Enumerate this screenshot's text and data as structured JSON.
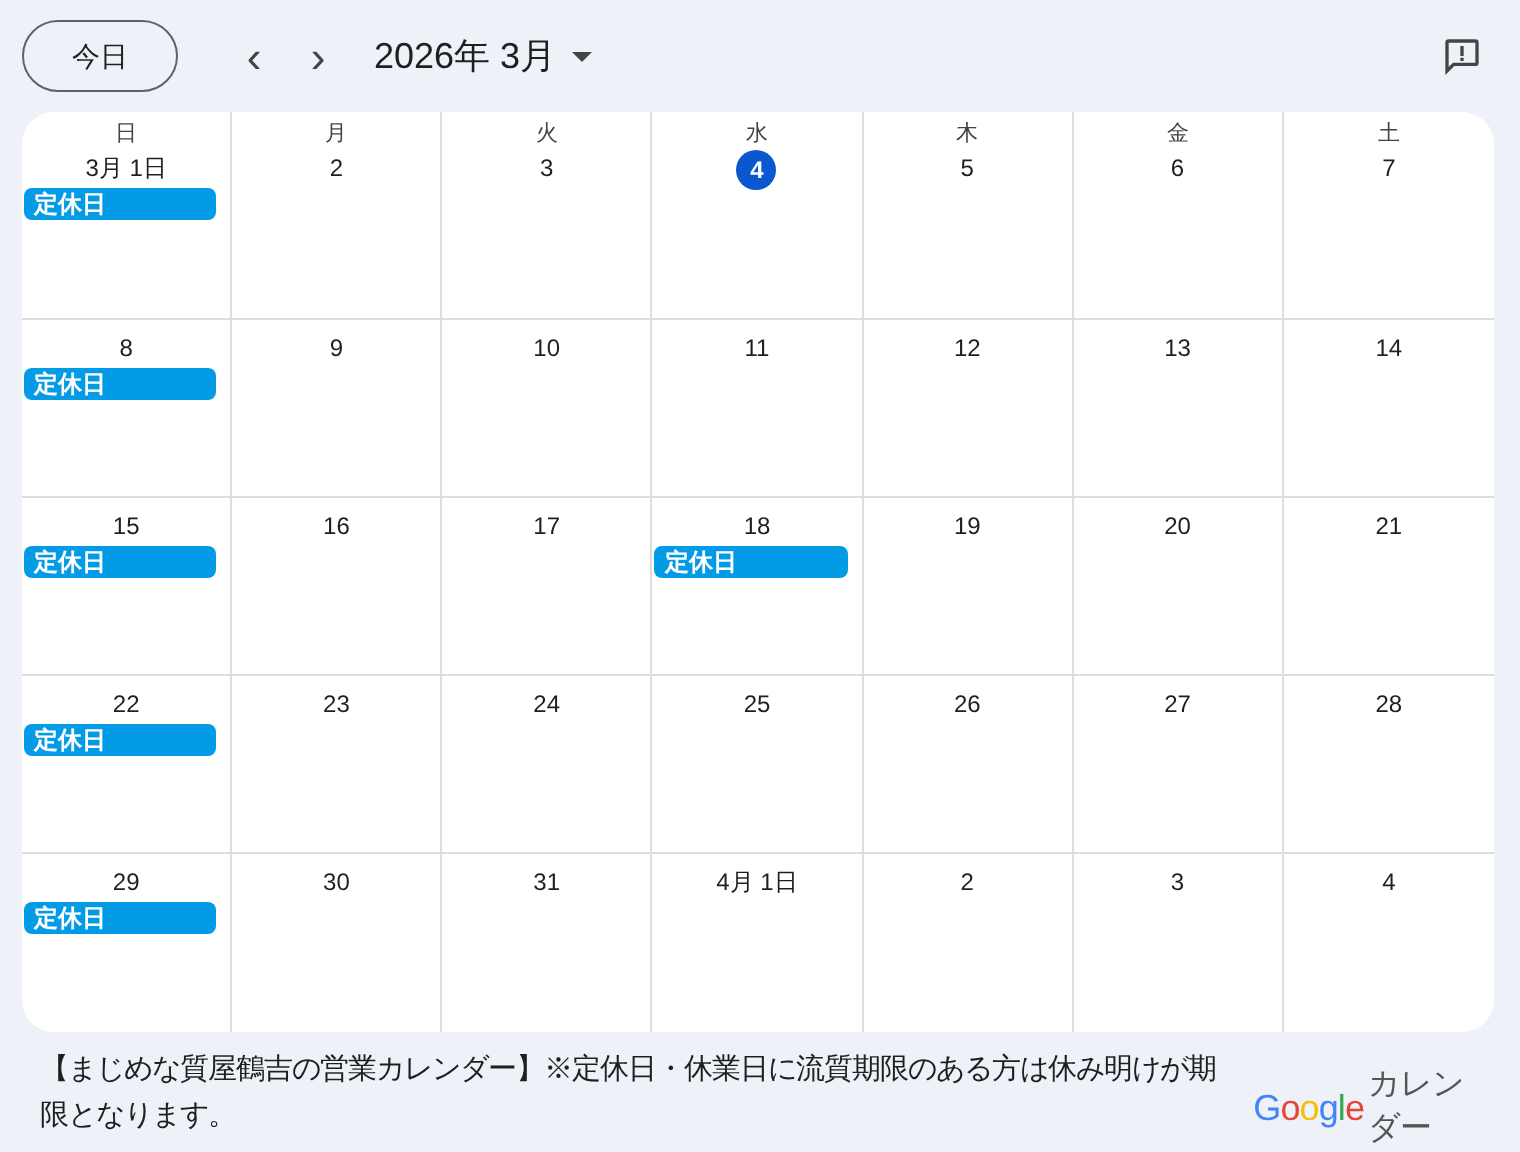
{
  "toolbar": {
    "today_button": "今日",
    "prev": "‹",
    "next": "›",
    "month_title": "2026年 3月"
  },
  "weekdays": [
    "日",
    "月",
    "火",
    "水",
    "木",
    "金",
    "土"
  ],
  "weeks": [
    {
      "days": [
        {
          "date": "3月 1日",
          "today": false,
          "events": [
            "定休日"
          ]
        },
        {
          "date": "2",
          "today": false
        },
        {
          "date": "3",
          "today": false
        },
        {
          "date": "4",
          "today": true
        },
        {
          "date": "5",
          "today": false
        },
        {
          "date": "6",
          "today": false
        },
        {
          "date": "7",
          "today": false
        }
      ]
    },
    {
      "days": [
        {
          "date": "8",
          "today": false,
          "events": [
            "定休日"
          ]
        },
        {
          "date": "9",
          "today": false
        },
        {
          "date": "10",
          "today": false
        },
        {
          "date": "11",
          "today": false
        },
        {
          "date": "12",
          "today": false
        },
        {
          "date": "13",
          "today": false
        },
        {
          "date": "14",
          "today": false
        }
      ]
    },
    {
      "days": [
        {
          "date": "15",
          "today": false,
          "events": [
            "定休日"
          ]
        },
        {
          "date": "16",
          "today": false
        },
        {
          "date": "17",
          "today": false
        },
        {
          "date": "18",
          "today": false,
          "events": [
            "定休日"
          ]
        },
        {
          "date": "19",
          "today": false
        },
        {
          "date": "20",
          "today": false
        },
        {
          "date": "21",
          "today": false
        }
      ]
    },
    {
      "days": [
        {
          "date": "22",
          "today": false,
          "events": [
            "定休日"
          ]
        },
        {
          "date": "23",
          "today": false
        },
        {
          "date": "24",
          "today": false
        },
        {
          "date": "25",
          "today": false
        },
        {
          "date": "26",
          "today": false
        },
        {
          "date": "27",
          "today": false
        },
        {
          "date": "28",
          "today": false
        }
      ]
    },
    {
      "days": [
        {
          "date": "29",
          "today": false,
          "events": [
            "定休日"
          ]
        },
        {
          "date": "30",
          "today": false
        },
        {
          "date": "31",
          "today": false
        },
        {
          "date": "4月 1日",
          "today": false
        },
        {
          "date": "2",
          "today": false
        },
        {
          "date": "3",
          "today": false
        },
        {
          "date": "4",
          "today": false
        }
      ]
    }
  ],
  "footer": {
    "description": "【まじめな質屋鶴吉の営業カレンダー】※定休日・休業日に流質期限のある方は休み明けが期限となります。",
    "brand": "Google",
    "brand_suffix": "カレンダー"
  }
}
